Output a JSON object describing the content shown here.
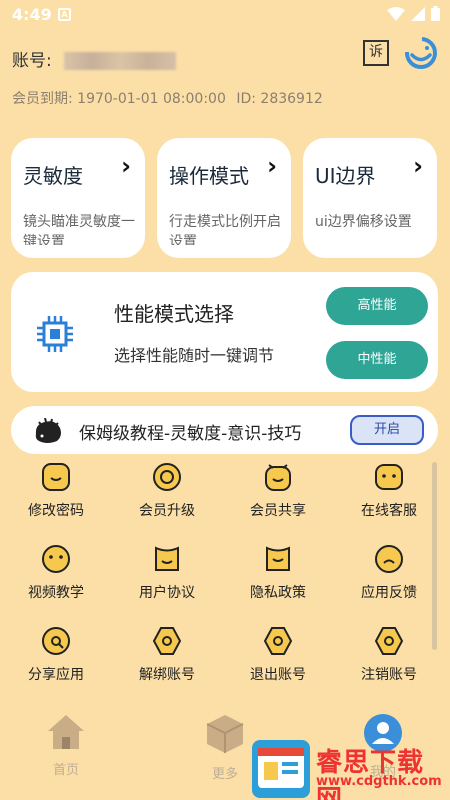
{
  "status": {
    "time": "4:49",
    "notif": "A"
  },
  "account": {
    "label": "账号:",
    "vip_label": "会员到期:",
    "vip_expire": "1970-01-01 08:00:00",
    "id_label": "ID:",
    "id_value": "2836912"
  },
  "header": {
    "complain_icon": "诉"
  },
  "cards": [
    {
      "title": "灵敏度",
      "desc": "镜头瞄准灵敏度一键设置"
    },
    {
      "title": "操作模式",
      "desc": "行走模式比例开启设置"
    },
    {
      "title": "UI边界",
      "desc": "ui边界偏移设置"
    }
  ],
  "perf": {
    "title": "性能模式选择",
    "desc": "选择性能随时一键调节",
    "btn_high": "高性能",
    "btn_mid": "中性能",
    "accent": "#2fa596"
  },
  "tutorial": {
    "text": "保姆级教程-灵敏度-意识-技巧",
    "btn": "开启"
  },
  "grid": [
    {
      "label": "修改密码",
      "icon": "face-smile-square-icon"
    },
    {
      "label": "会员升级",
      "icon": "face-circle-icon"
    },
    {
      "label": "会员共享",
      "icon": "face-alarm-icon"
    },
    {
      "label": "在线客服",
      "icon": "face-chat-icon"
    },
    {
      "label": "视频教学",
      "icon": "face-round-icon"
    },
    {
      "label": "用户协议",
      "icon": "face-doc-icon"
    },
    {
      "label": "隐私政策",
      "icon": "face-shield-icon"
    },
    {
      "label": "应用反馈",
      "icon": "face-sad-icon"
    },
    {
      "label": "分享应用",
      "icon": "face-share-icon"
    },
    {
      "label": "解绑账号",
      "icon": "face-hex-icon"
    },
    {
      "label": "退出账号",
      "icon": "face-hex-icon"
    },
    {
      "label": "注销账号",
      "icon": "face-hex-icon"
    }
  ],
  "tabs": [
    {
      "label": "首页"
    },
    {
      "label": "更多"
    },
    {
      "label": "我的"
    }
  ],
  "watermark": {
    "name": "睿思下载网",
    "url": "www.cdgthk.com"
  },
  "colors": {
    "background": "#fbdfa7",
    "icon_yellow": "#f6c94e"
  }
}
